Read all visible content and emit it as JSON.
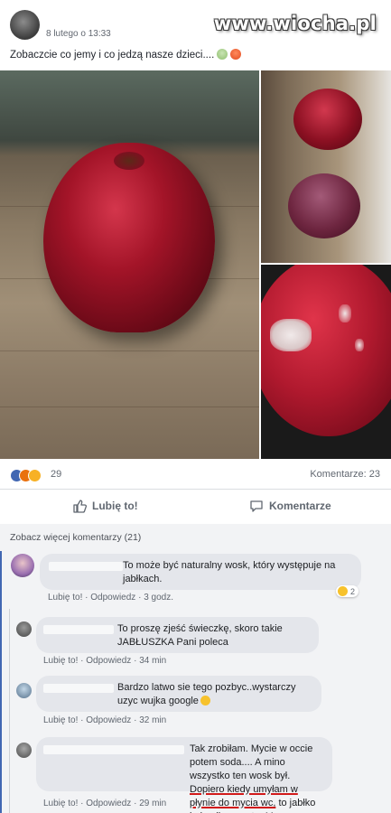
{
  "post": {
    "timestamp": "8 lutego o 13:33",
    "text": "Zobaczcie co jemy i co jedzą nasze dzieci....",
    "emoji_icons": [
      "sad-face-icon",
      "angry-face-icon"
    ]
  },
  "watermark": "www.wiocha.pl",
  "stats": {
    "reaction_icons": [
      "like-icon",
      "angry-icon",
      "sad-icon"
    ],
    "reactions_count": "29",
    "comments_count": "Komentarze: 23"
  },
  "actions": {
    "like_label": "Lubię to!",
    "comment_label": "Komentarze"
  },
  "comments_section": {
    "more_label": "Zobacz więcej komentarzy (21)"
  },
  "comments": [
    {
      "text": "To może być naturalny wosk, który występuje na jabłkach.",
      "like": "Lubię to!",
      "reply": "Odpowiedz",
      "time": "3 godz.",
      "reaction_count": "2"
    },
    {
      "text": "To proszę zjeść świeczkę, skoro takie JABŁUSZKA Pani poleca",
      "like": "Lubię to!",
      "reply": "Odpowiedz",
      "time": "34 min"
    },
    {
      "text": "Bardzo latwo sie tego pozbyc..wystarczy uzyc wujka google",
      "like": "Lubię to!",
      "reply": "Odpowiedz",
      "time": "32 min"
    },
    {
      "text_before": "Tak zrobiłam. Mycie w occie potem soda.... A mino wszystko ten wosk był.",
      "text_underlined": "Dopiero kiedy umyłam w płynie do mycia wc,",
      "text_after": "to jabłko było niby czyste. My rezygnujemy z owoców",
      "like": "Lubię to!",
      "reply": "Odpowiedz",
      "time": "29 min"
    }
  ],
  "colors": {
    "accent": "#4267b2",
    "underline": "#d11a1a"
  }
}
